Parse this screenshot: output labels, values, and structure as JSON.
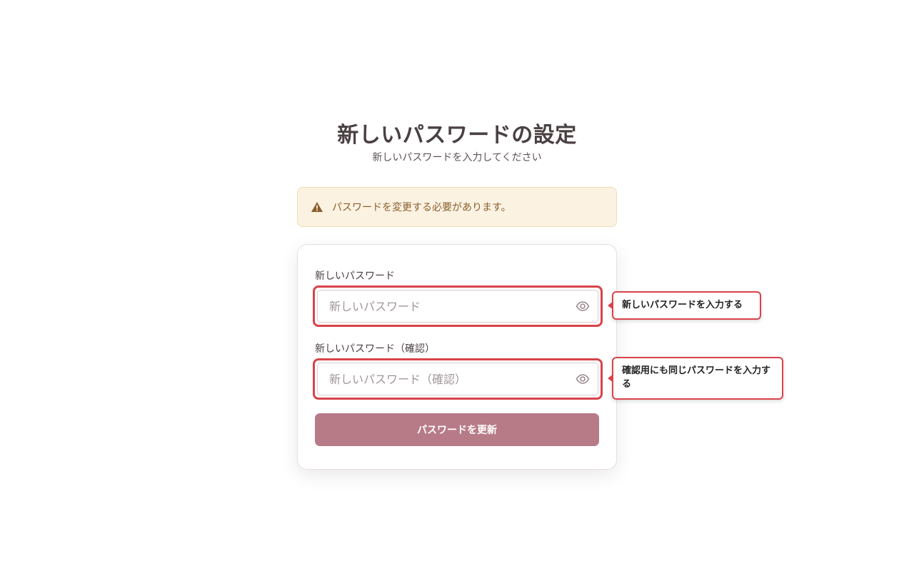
{
  "header": {
    "title": "新しいパスワードの設定",
    "subtitle": "新しいパスワードを入力してください"
  },
  "alert": {
    "icon": "warning-triangle-icon",
    "message": "パスワードを変更する必要があります。"
  },
  "form": {
    "new_password": {
      "label": "新しいパスワード",
      "placeholder": "新しいパスワード",
      "value": ""
    },
    "confirm_password": {
      "label": "新しいパスワード（確認）",
      "placeholder": "新しいパスワード（確認）",
      "value": ""
    },
    "toggle_icon": "eye-icon",
    "submit_label": "パスワードを更新"
  },
  "callouts": {
    "new_password": "新しいパスワードを入力する",
    "confirm_password": "確認用にも同じパスワードを入力する"
  },
  "colors": {
    "accent": "#b77b88",
    "highlight": "#d9434b",
    "alert_bg": "#fbf2e2",
    "alert_text": "#8a5f2c"
  }
}
